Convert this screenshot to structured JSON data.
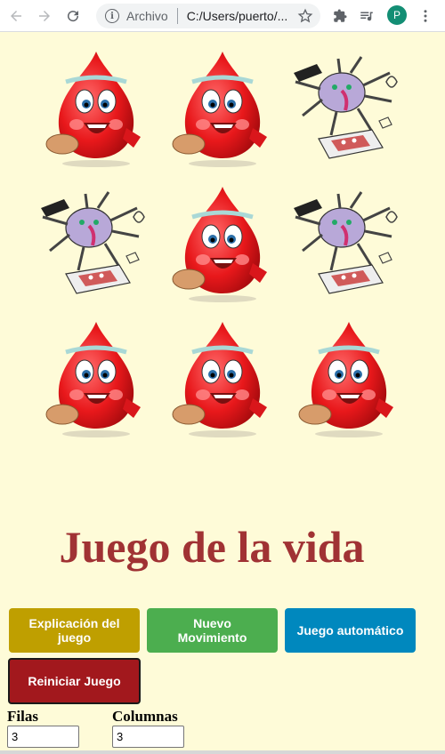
{
  "browser": {
    "omnibox_label": "Archivo",
    "url": "C:/Users/puerto/...",
    "profile_initial": "P"
  },
  "grid": {
    "rows": 3,
    "cols": 3,
    "cells": [
      [
        "alive",
        "alive",
        "dead"
      ],
      [
        "dead",
        "alive",
        "dead"
      ],
      [
        "alive",
        "alive",
        "alive"
      ]
    ]
  },
  "page": {
    "title": "Juego de la vida"
  },
  "buttons": {
    "explain": "Explicación del juego",
    "move": "Nuevo Movimiento",
    "auto": "Juego automático",
    "reset": "Reiniciar Juego"
  },
  "fields": {
    "rows_label": "Filas",
    "rows_value": "3",
    "cols_label": "Columnas",
    "cols_value": "3"
  },
  "colors": {
    "background": "#fefbd8",
    "title": "#a03234",
    "explain": "#bf9f00",
    "move": "#4cae4f",
    "auto": "#0088be",
    "reset": "#a2181d"
  }
}
